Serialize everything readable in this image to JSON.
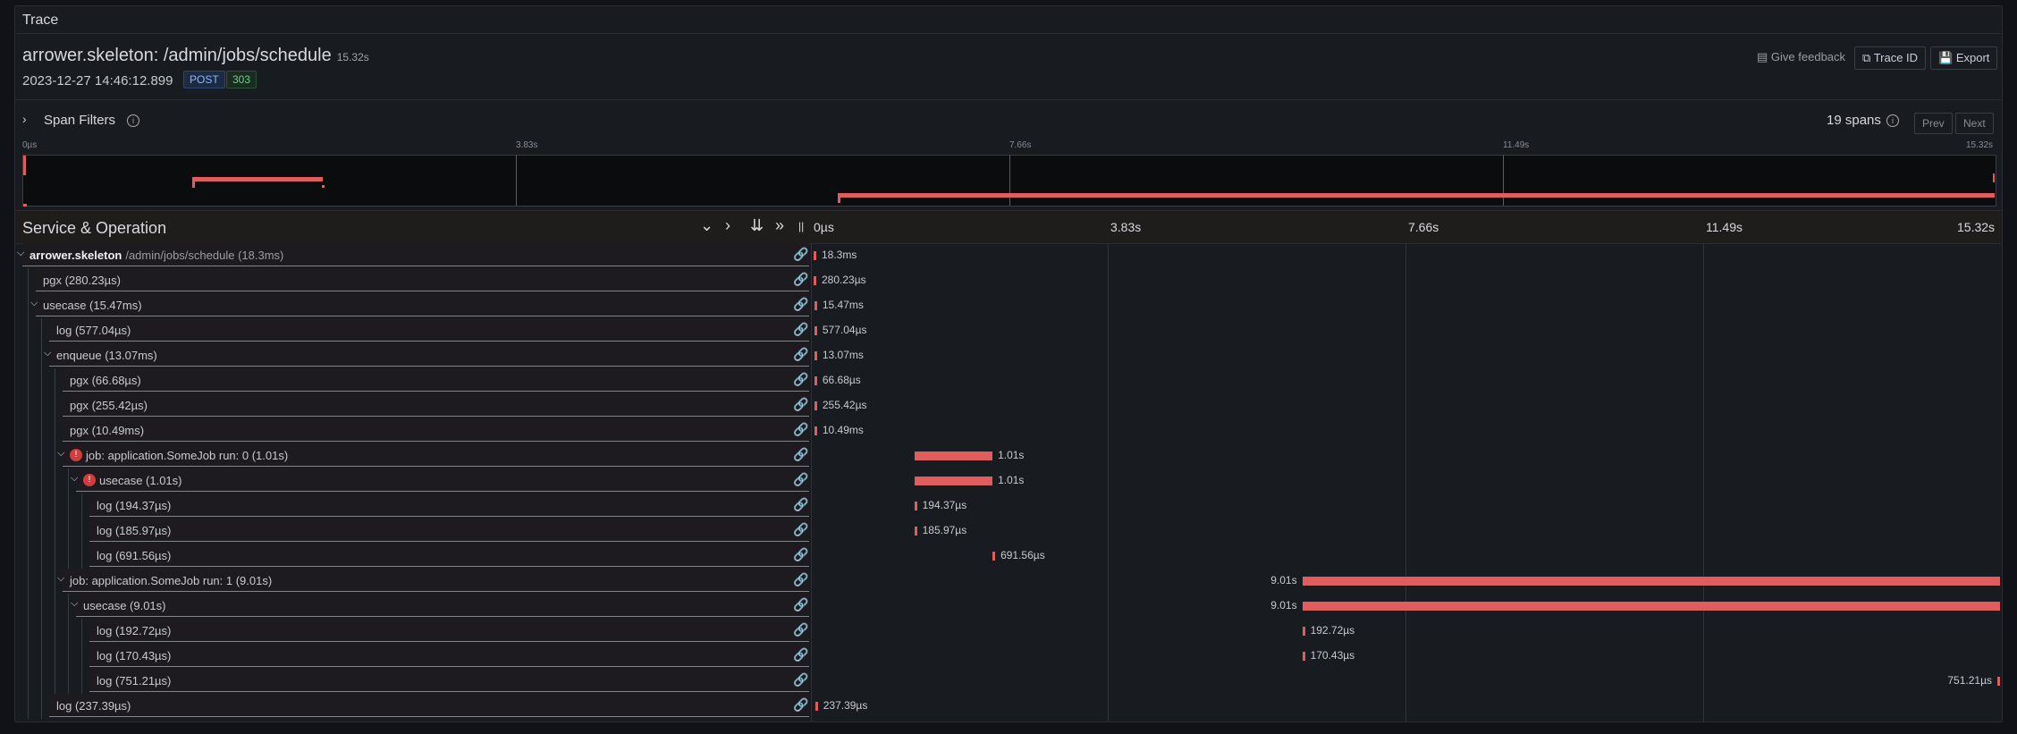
{
  "panel": {
    "title": "Trace"
  },
  "trace": {
    "service": "arrower.skeleton",
    "operation": "/admin/jobs/schedule",
    "title": "arrower.skeleton: /admin/jobs/schedule",
    "duration": "15.32s",
    "timestamp": "2023-12-27 14:46:12.899",
    "method": "POST",
    "status": "303"
  },
  "toolbar": {
    "feedback_label": "Give feedback",
    "trace_id_label": "Trace ID",
    "export_label": "Export"
  },
  "filters": {
    "label": "Span Filters",
    "spans_count": "19 spans",
    "prev_label": "Prev",
    "next_label": "Next"
  },
  "minimap": {
    "ticks": [
      "0µs",
      "3.83s",
      "7.66s",
      "11.49s",
      "15.32s"
    ]
  },
  "timeline": {
    "header": "Service & Operation",
    "ticks": [
      "0µs",
      "3.83s",
      "7.66s",
      "11.49s",
      "15.32s"
    ]
  },
  "spans": [
    {
      "label": "arrower.skeleton",
      "op": "/admin/jobs/schedule (18.3ms)",
      "depth": 0,
      "caret": true,
      "error": false,
      "bold": true,
      "start_s": 0,
      "dur_label": "18.3ms",
      "dur_s": 0.0183,
      "label_side": "right"
    },
    {
      "label": "pgx (280.23µs)",
      "depth": 1,
      "caret": false,
      "error": false,
      "start_s": 0,
      "dur_label": "280.23µs",
      "dur_s": 0.00028,
      "label_side": "right"
    },
    {
      "label": "usecase (15.47ms)",
      "depth": 1,
      "caret": true,
      "error": false,
      "start_s": 0.01,
      "dur_label": "15.47ms",
      "dur_s": 0.01547,
      "label_side": "right"
    },
    {
      "label": "log (577.04µs)",
      "depth": 2,
      "caret": false,
      "error": false,
      "start_s": 0.01,
      "dur_label": "577.04µs",
      "dur_s": 0.00058,
      "label_side": "right"
    },
    {
      "label": "enqueue (13.07ms)",
      "depth": 2,
      "caret": true,
      "error": false,
      "start_s": 0.01,
      "dur_label": "13.07ms",
      "dur_s": 0.01307,
      "label_side": "right"
    },
    {
      "label": "pgx (66.68µs)",
      "depth": 3,
      "caret": false,
      "error": false,
      "start_s": 0.01,
      "dur_label": "66.68µs",
      "dur_s": 7e-05,
      "label_side": "right"
    },
    {
      "label": "pgx (255.42µs)",
      "depth": 3,
      "caret": false,
      "error": false,
      "start_s": 0.01,
      "dur_label": "255.42µs",
      "dur_s": 0.00026,
      "label_side": "right"
    },
    {
      "label": "pgx (10.49ms)",
      "depth": 3,
      "caret": false,
      "error": false,
      "start_s": 0.01,
      "dur_label": "10.49ms",
      "dur_s": 0.01049,
      "label_side": "right"
    },
    {
      "label": "job: application.SomeJob run: 0 (1.01s)",
      "depth": 3,
      "caret": true,
      "error": true,
      "start_s": 1.3,
      "dur_label": "1.01s",
      "dur_s": 1.01,
      "label_side": "right"
    },
    {
      "label": "usecase (1.01s)",
      "depth": 4,
      "caret": true,
      "error": true,
      "start_s": 1.3,
      "dur_label": "1.01s",
      "dur_s": 1.01,
      "label_side": "right"
    },
    {
      "label": "log (194.37µs)",
      "depth": 5,
      "caret": false,
      "error": false,
      "start_s": 1.3,
      "dur_label": "194.37µs",
      "dur_s": 0.0002,
      "label_side": "right"
    },
    {
      "label": "log (185.97µs)",
      "depth": 5,
      "caret": false,
      "error": false,
      "start_s": 1.3,
      "dur_label": "185.97µs",
      "dur_s": 0.0002,
      "label_side": "right"
    },
    {
      "label": "log (691.56µs)",
      "depth": 5,
      "caret": false,
      "error": false,
      "start_s": 2.31,
      "dur_label": "691.56µs",
      "dur_s": 0.0007,
      "label_side": "right"
    },
    {
      "label": "job: application.SomeJob run: 1 (9.01s)",
      "depth": 3,
      "caret": true,
      "error": false,
      "start_s": 6.31,
      "dur_label": "9.01s",
      "dur_s": 9.01,
      "label_side": "left"
    },
    {
      "label": "usecase (9.01s)",
      "depth": 4,
      "caret": true,
      "error": false,
      "start_s": 6.31,
      "dur_label": "9.01s",
      "dur_s": 9.01,
      "label_side": "left"
    },
    {
      "label": "log (192.72µs)",
      "depth": 5,
      "caret": false,
      "error": false,
      "start_s": 6.31,
      "dur_label": "192.72µs",
      "dur_s": 0.0002,
      "label_side": "right"
    },
    {
      "label": "log (170.43µs)",
      "depth": 5,
      "caret": false,
      "error": false,
      "start_s": 6.31,
      "dur_label": "170.43µs",
      "dur_s": 0.0002,
      "label_side": "right"
    },
    {
      "label": "log (751.21µs)",
      "depth": 5,
      "caret": false,
      "error": false,
      "start_s": 15.32,
      "dur_label": "751.21µs",
      "dur_s": 0.0008,
      "label_side": "left"
    },
    {
      "label": "log (237.39µs)",
      "depth": 2,
      "caret": false,
      "error": false,
      "start_s": 0.02,
      "dur_label": "237.39µs",
      "dur_s": 0.0002,
      "label_side": "right"
    }
  ],
  "colors": {
    "span": "#e05d5d",
    "error": "#d13c3c",
    "background": "#181b1f"
  }
}
